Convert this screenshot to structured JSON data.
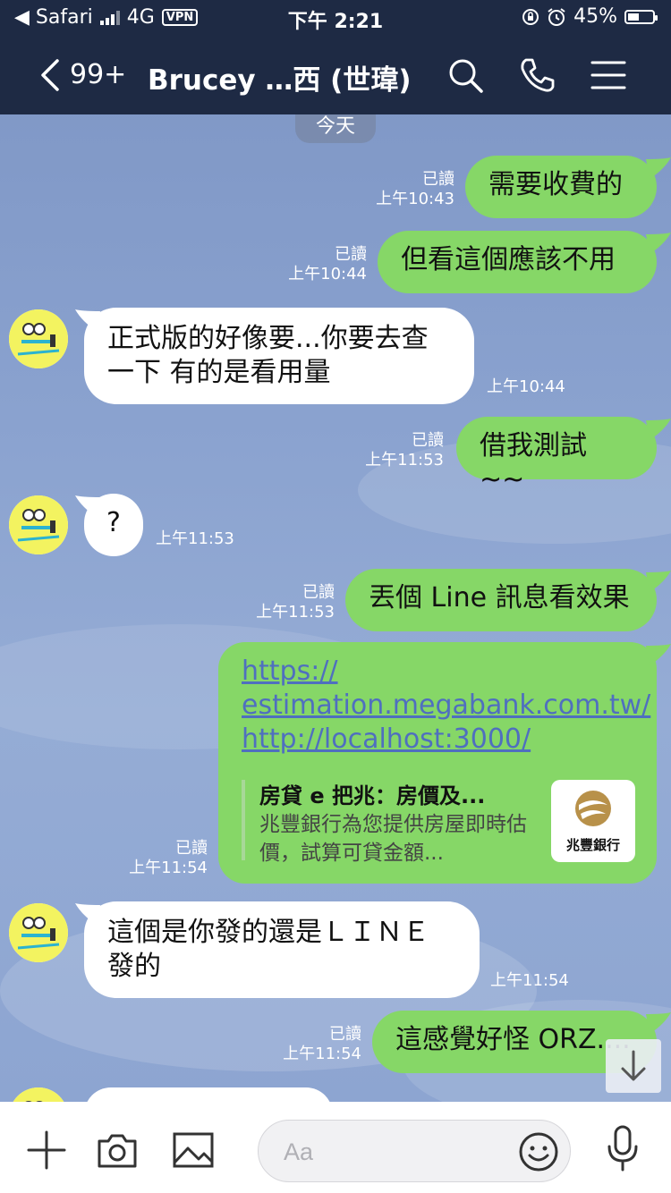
{
  "status_bar": {
    "carrier": "◀ Safari",
    "network": "4G",
    "vpn": "VPN",
    "time": "下午 2:21",
    "battery": "45%",
    "battery_level": 0.45
  },
  "nav": {
    "unread_count": "99+",
    "chat_title": "Brucey …西 (世瑋)"
  },
  "chat": {
    "date_divider": "今天",
    "messages": [
      {
        "text": "需要收費的",
        "read": "已讀",
        "time": "上午10:43"
      },
      {
        "text": "但看這個應該不用",
        "read": "已讀",
        "time": "上午10:44"
      },
      {
        "text_line1": "正式版的好像要...你要去查",
        "text_line2": "一下 有的是看用量",
        "time": "上午10:44"
      },
      {
        "text": "借我測試 ~~",
        "read": "已讀",
        "time": "上午11:53"
      },
      {
        "text": "?",
        "time": "上午11:53"
      },
      {
        "text": "丟個 Line 訊息看效果",
        "read": "已讀",
        "time": "上午11:53"
      },
      {
        "link_line1": "https://",
        "link_line2": "estimation.megabank.com.tw/",
        "link_line3": "http://localhost:3000/",
        "preview_title": "房貸 e 把兆：房價及...",
        "preview_desc": "兆豐銀行為您提供房屋即時估價，試算可貸金額...",
        "preview_logo_text": "兆豐銀行",
        "read": "已讀",
        "time": "上午11:54"
      },
      {
        "text_line1": "這個是你發的還是ＬＩＮＥ",
        "text_line2": "發的",
        "time": "上午11:54"
      },
      {
        "text": "這感覺好怪 ORZ....",
        "read": "已讀",
        "time": "上午11:54"
      }
    ]
  },
  "input": {
    "placeholder": "Aa"
  }
}
